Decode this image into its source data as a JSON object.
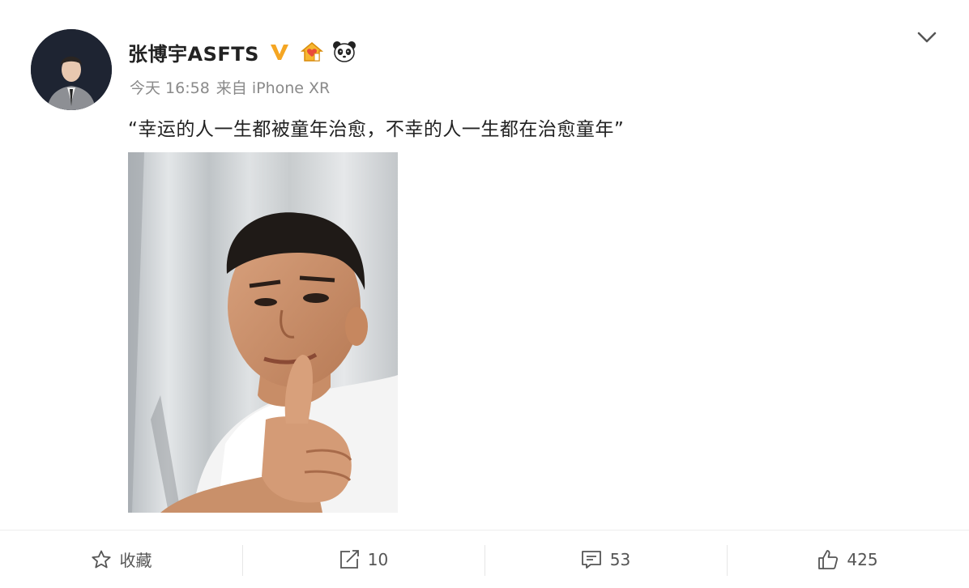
{
  "post": {
    "username": "张博宇ASFTS",
    "timestamp": "今天 16:58",
    "source": "来自 iPhone XR",
    "text": "“幸运的人一生都被童年治愈，不幸的人一生都在治愈童年”"
  },
  "badges": [
    "verified-v-icon",
    "home-badge-icon",
    "panda-icon"
  ],
  "actions": {
    "favorite_label": "收藏",
    "repost_count": "10",
    "comment_count": "53",
    "like_count": "425"
  },
  "colors": {
    "verified": "#f5a623",
    "text": "#222222",
    "meta": "#8a8a8a"
  }
}
